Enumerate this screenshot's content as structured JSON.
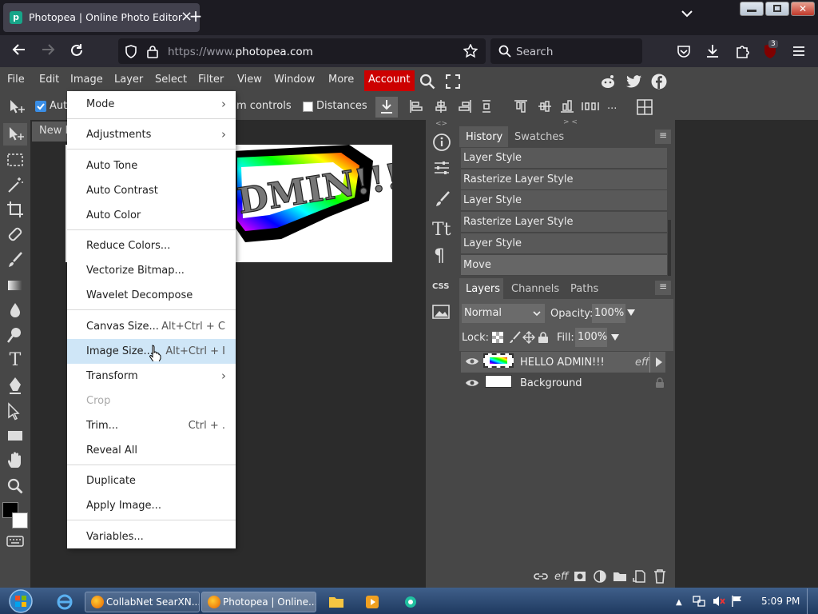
{
  "browser": {
    "tab_title": "Photopea | Online Photo Editor",
    "new_tab": "+",
    "url_dim": "https://www.",
    "url_main": "photopea.com",
    "search_placeholder": "Search",
    "ext_badge": "3"
  },
  "menubar": {
    "items": [
      "File",
      "Edit",
      "Image",
      "Layer",
      "Select",
      "Filter",
      "View",
      "Window",
      "More"
    ],
    "account": "Account"
  },
  "options": {
    "auto_select": "Auto",
    "transform_controls": "m controls",
    "distances": "Distances",
    "more": "...",
    "collapse": ">  <"
  },
  "document": {
    "tab": "New P",
    "text": "DMIN!!!"
  },
  "image_menu": {
    "items": [
      {
        "label": "Mode",
        "shortcut": "",
        "submenu": true,
        "disabled": false
      },
      {
        "label": "Adjustments",
        "shortcut": "",
        "submenu": true,
        "disabled": false
      },
      {
        "label": "Auto Tone",
        "shortcut": "",
        "submenu": false,
        "disabled": false
      },
      {
        "label": "Auto Contrast",
        "shortcut": "",
        "submenu": false,
        "disabled": false
      },
      {
        "label": "Auto Color",
        "shortcut": "",
        "submenu": false,
        "disabled": false
      },
      {
        "label": "Reduce Colors...",
        "shortcut": "",
        "submenu": false,
        "disabled": false
      },
      {
        "label": "Vectorize Bitmap...",
        "shortcut": "",
        "submenu": false,
        "disabled": false
      },
      {
        "label": "Wavelet Decompose",
        "shortcut": "",
        "submenu": false,
        "disabled": false
      },
      {
        "label": "Canvas Size...",
        "shortcut": "Alt+Ctrl + C",
        "submenu": false,
        "disabled": false
      },
      {
        "label": "Image Size...",
        "shortcut": "Alt+Ctrl + I",
        "submenu": false,
        "disabled": false,
        "highlighted": true
      },
      {
        "label": "Transform",
        "shortcut": "",
        "submenu": true,
        "disabled": false
      },
      {
        "label": "Crop",
        "shortcut": "",
        "submenu": false,
        "disabled": true
      },
      {
        "label": "Trim...",
        "shortcut": "Ctrl + .",
        "submenu": false,
        "disabled": false
      },
      {
        "label": "Reveal All",
        "shortcut": "",
        "submenu": false,
        "disabled": false
      },
      {
        "label": "Duplicate",
        "shortcut": "",
        "submenu": false,
        "disabled": false
      },
      {
        "label": "Apply Image...",
        "shortcut": "",
        "submenu": false,
        "disabled": false
      },
      {
        "label": "Variables...",
        "shortcut": "",
        "submenu": false,
        "disabled": false
      }
    ]
  },
  "history": {
    "tabs": [
      "History",
      "Swatches"
    ],
    "entries": [
      "Layer Style",
      "Rasterize Layer Style",
      "Layer Style",
      "Rasterize Layer Style",
      "Layer Style",
      "Move"
    ]
  },
  "layers": {
    "tabs": [
      "Layers",
      "Channels",
      "Paths"
    ],
    "blend_mode": "Normal",
    "opacity_label": "Opacity:",
    "opacity": "100%",
    "lock_label": "Lock:",
    "fill_label": "Fill:",
    "fill": "100%",
    "items": [
      {
        "name": "HELLO ADMIN!!!",
        "effects": "eff"
      },
      {
        "name": "Background",
        "effects": ""
      }
    ]
  },
  "css_label": "CSS",
  "taskbar": {
    "items": [
      "CollabNet SearXN...",
      "Photopea | Online..."
    ],
    "time": "5:09 PM"
  }
}
